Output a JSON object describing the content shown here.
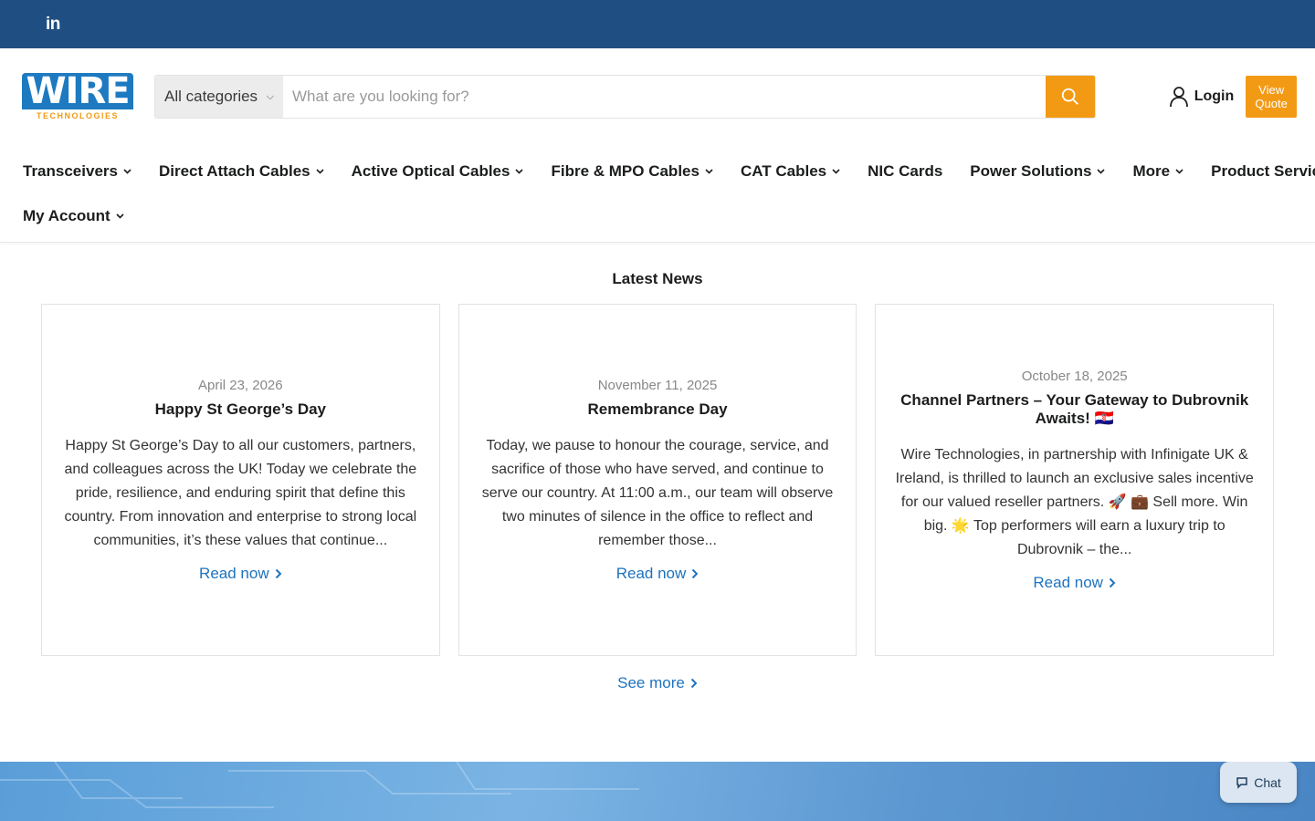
{
  "topbar": {
    "social_icon": "linkedin-icon",
    "social_label": "in"
  },
  "header": {
    "logo_word": "WIRE",
    "logo_sub": "TECHNOLOGIES",
    "category_label": "All categories",
    "search_placeholder": "What are you looking for?",
    "login_label": "Login",
    "quote_label": "View Quote"
  },
  "nav": {
    "row1": [
      {
        "label": "Transceivers",
        "dropdown": true
      },
      {
        "label": "Direct Attach Cables",
        "dropdown": true
      },
      {
        "label": "Active Optical Cables",
        "dropdown": true
      },
      {
        "label": "Fibre & MPO Cables",
        "dropdown": true
      },
      {
        "label": "CAT Cables",
        "dropdown": true
      },
      {
        "label": "NIC Cards",
        "dropdown": false
      },
      {
        "label": "Power Solutions",
        "dropdown": true
      },
      {
        "label": "More",
        "dropdown": true
      },
      {
        "label": "Product Services",
        "dropdown": true
      }
    ],
    "row2": [
      {
        "label": "My Account",
        "dropdown": true
      }
    ]
  },
  "news": {
    "title": "Latest News",
    "read_label": "Read now",
    "see_more": "See more",
    "articles": [
      {
        "date": "April 23, 2026",
        "title": "Happy St George’s Day",
        "excerpt": "Happy St George’s Day to all our customers, partners, and colleagues across the UK! Today we celebrate the pride, resilience, and enduring spirit that define this country. From innovation and enterprise to strong local communities, it’s these values that continue..."
      },
      {
        "date": "November 11, 2025",
        "title": "Remembrance Day",
        "excerpt": "Today, we pause to honour the courage, service, and sacrifice of those who have served, and continue to serve our country. At 11:00 a.m., our team will observe two minutes of silence in the office to reflect and remember those..."
      },
      {
        "date": "October 18, 2025",
        "title": "Channel Partners – Your Gateway to Dubrovnik Awaits! 🇭🇷",
        "excerpt": "Wire Technologies, in partnership with Infinigate UK & Ireland, is thrilled to launch an exclusive sales incentive for our valued reseller partners. 🚀 💼 Sell more. Win big. 🌟 Top performers will earn a luxury trip to Dubrovnik – the..."
      }
    ]
  },
  "chat": {
    "label": "Chat"
  },
  "colors": {
    "topbar": "#1f4f82",
    "accent": "#f39a14",
    "link": "#1e73be"
  }
}
